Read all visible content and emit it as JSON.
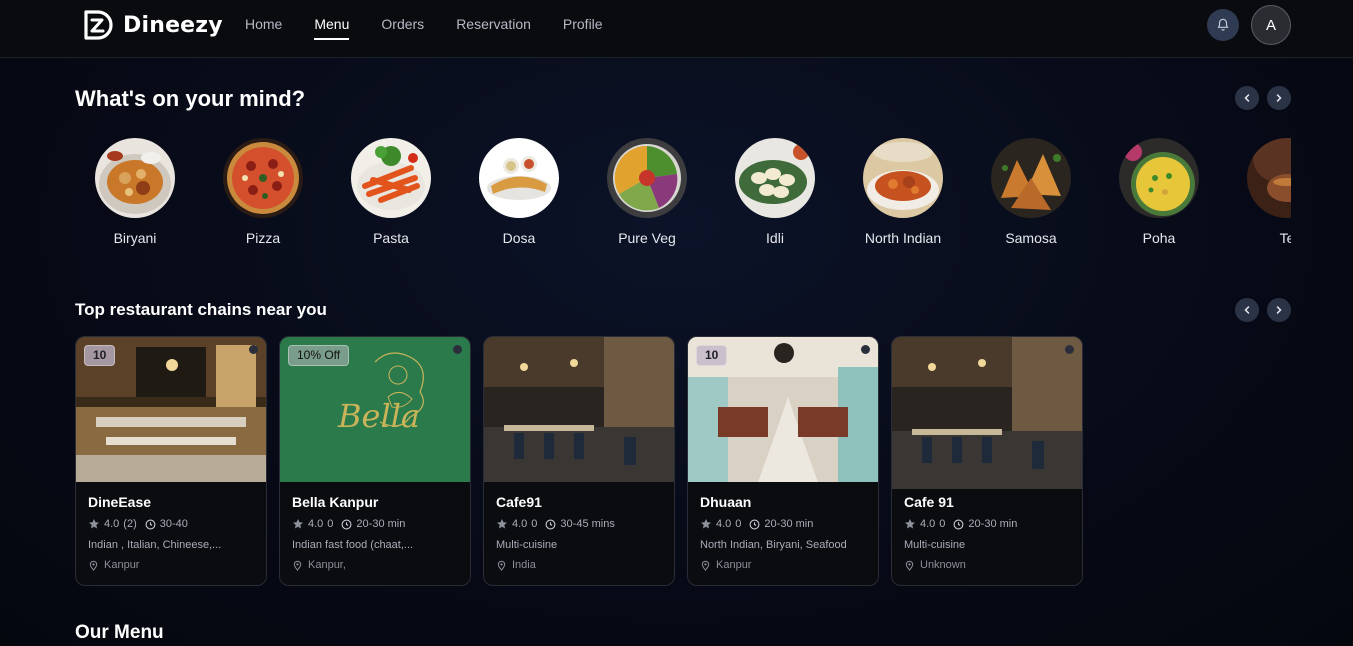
{
  "app": {
    "name": "Dineezy"
  },
  "nav": {
    "links": [
      {
        "label": "Home",
        "active": false
      },
      {
        "label": "Menu",
        "active": true
      },
      {
        "label": "Orders",
        "active": false
      },
      {
        "label": "Reservation",
        "active": false
      },
      {
        "label": "Profile",
        "active": false
      }
    ],
    "bell_icon": "bell-icon",
    "avatar_initial": "A"
  },
  "mind": {
    "title": "What's on your mind?",
    "categories": [
      {
        "label": "Biryani"
      },
      {
        "label": "Pizza"
      },
      {
        "label": "Pasta"
      },
      {
        "label": "Dosa"
      },
      {
        "label": "Pure Veg"
      },
      {
        "label": "Idli"
      },
      {
        "label": "North Indian"
      },
      {
        "label": "Samosa"
      },
      {
        "label": "Poha"
      },
      {
        "label": "Te"
      }
    ]
  },
  "chains": {
    "title": "Top restaurant chains near you",
    "restaurants": [
      {
        "name": "DineEase",
        "badge": "10",
        "rating": "4.0",
        "reviews": "(2)",
        "time": "30-40",
        "cuisine": "Indian , Italian, Chineese,...",
        "location": "Kanpur"
      },
      {
        "name": "Bella Kanpur",
        "badge": "10% Off",
        "rating": "4.0",
        "reviews": "0",
        "time": "20-30 min",
        "cuisine": "Indian fast food (chaat,...",
        "location": "Kanpur,"
      },
      {
        "name": "Cafe91",
        "badge": "",
        "rating": "4.0",
        "reviews": "0",
        "time": "30-45 mins",
        "cuisine": "Multi-cuisine",
        "location": "India"
      },
      {
        "name": "Dhuaan",
        "badge": "10",
        "rating": "4.0",
        "reviews": "0",
        "time": "20-30 min",
        "cuisine": "North Indian, Biryani, Seafood",
        "location": "Kanpur"
      },
      {
        "name": "Cafe 91",
        "badge": "",
        "rating": "4.0",
        "reviews": "0",
        "time": "20-30 min",
        "cuisine": "Multi-cuisine",
        "location": "Unknown"
      }
    ]
  },
  "menu": {
    "title": "Our Menu"
  },
  "colors": {
    "background": "#070a16",
    "navbar": "#0a0b0f",
    "card": "#0b0c10",
    "arrow_button": "#2b3447",
    "bella_green": "#2b7a4b"
  }
}
